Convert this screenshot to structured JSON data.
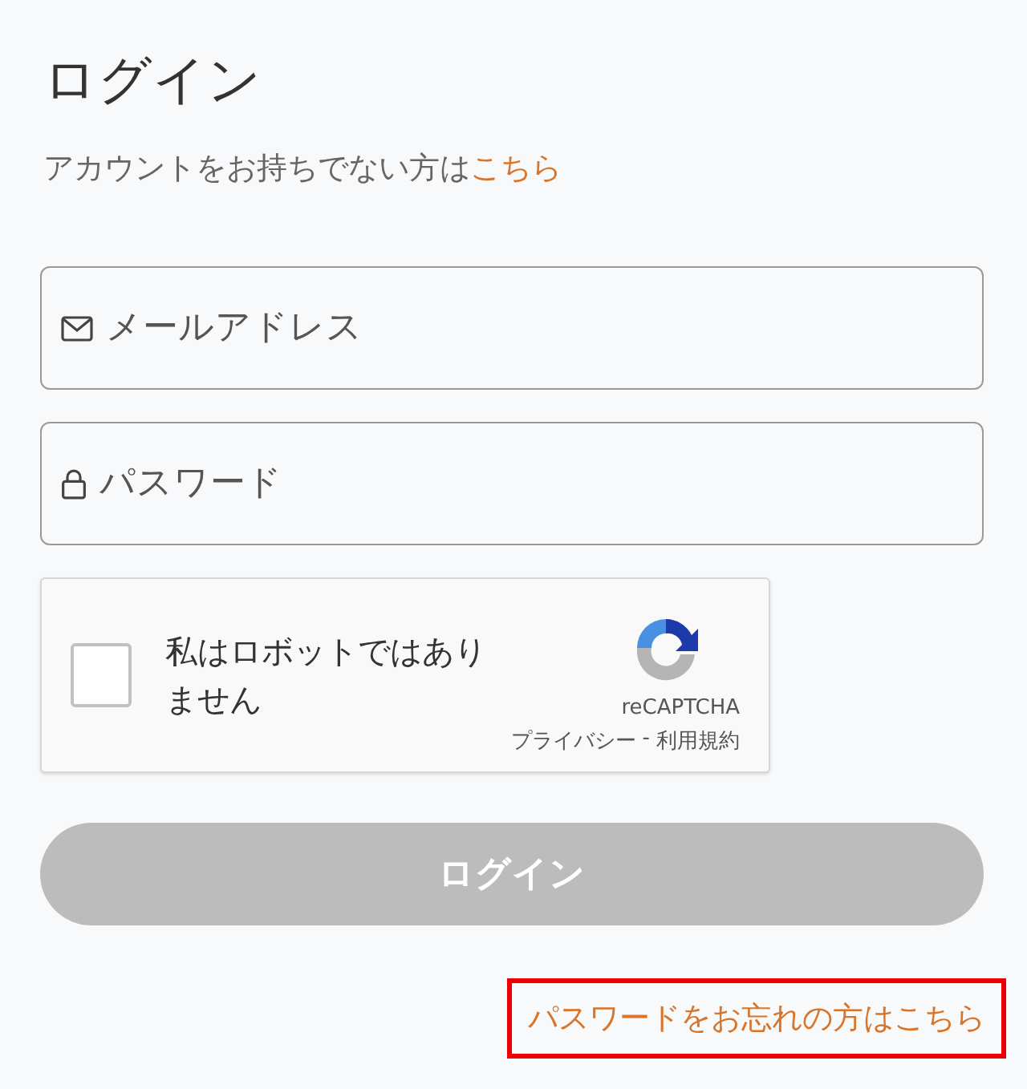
{
  "title": "ログイン",
  "signup": {
    "text": "アカウントをお持ちでない方は",
    "link": "こちら"
  },
  "fields": [
    {
      "kind": "email",
      "placeholder": "メールアドレス"
    },
    {
      "kind": "password",
      "placeholder": "パスワード"
    }
  ],
  "captcha": {
    "checked": false,
    "label": "私はロボットではありません",
    "brand": "reCAPTCHA",
    "privacy": "プライバシー",
    "separator": "-",
    "terms": "利用規約"
  },
  "login_button": {
    "label": "ログイン",
    "disabled": true
  },
  "forgot_link": {
    "label": "パスワードをお忘れの方はこちら",
    "highlighted": true
  }
}
